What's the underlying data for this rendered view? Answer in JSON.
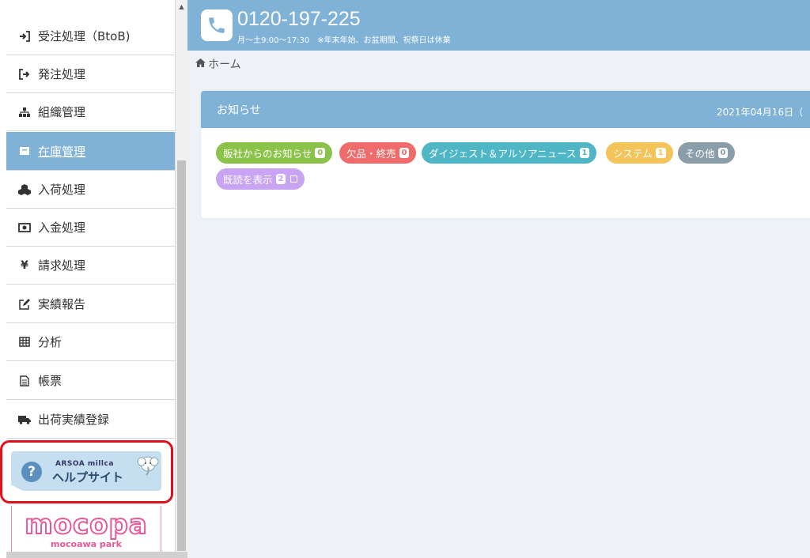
{
  "sidebar": {
    "items": [
      {
        "label": "受注処理（BtoB)",
        "icon": "sign-in-icon"
      },
      {
        "label": "発注処理",
        "icon": "sign-out-icon"
      },
      {
        "label": "組織管理",
        "icon": "sitemap-icon"
      },
      {
        "label": "在庫管理",
        "icon": "archive-icon",
        "active": true
      },
      {
        "label": "入荷処理",
        "icon": "cubes-icon"
      },
      {
        "label": "入金処理",
        "icon": "money-icon"
      },
      {
        "label": "請求処理",
        "icon": "yen-icon"
      },
      {
        "label": "実績報告",
        "icon": "edit-icon"
      },
      {
        "label": "分析",
        "icon": "table-icon"
      },
      {
        "label": "帳票",
        "icon": "file-icon"
      },
      {
        "label": "出荷実績登録",
        "icon": "truck-icon"
      }
    ],
    "yen_glyph": "¥"
  },
  "help": {
    "brand": "ARSOA millca",
    "title": "ヘルプサイト",
    "q": "?"
  },
  "mocopa": {
    "logo": "mocopa",
    "sub": "mocoawa park"
  },
  "header": {
    "phone": "0120-197-225",
    "hours": "月～土9:00～17:30　※年末年始、お盆期間、祝祭日は休業"
  },
  "breadcrumb": {
    "home": "ホーム"
  },
  "notice": {
    "title": "お知らせ",
    "date": "2021年04月16日（",
    "tags": [
      {
        "label": "販社からのお知らせ",
        "count": "0",
        "color": "#8bc34a"
      },
      {
        "label": "欠品・終売",
        "count": "0",
        "color": "#f06b6b"
      },
      {
        "label": "ダイジェスト＆アルソアニュース",
        "count": "1",
        "color": "#4fb6c6"
      },
      {
        "label": "システム",
        "count": "1",
        "color": "#f2c45a"
      },
      {
        "label": "その他",
        "count": "0",
        "color": "#8a9ea9"
      },
      {
        "label": "既読を表示",
        "count": "2",
        "color": "#c9a4f2"
      }
    ]
  },
  "colors": {
    "accent": "#7fb2d6",
    "highlight_frame": "#e0101a"
  }
}
